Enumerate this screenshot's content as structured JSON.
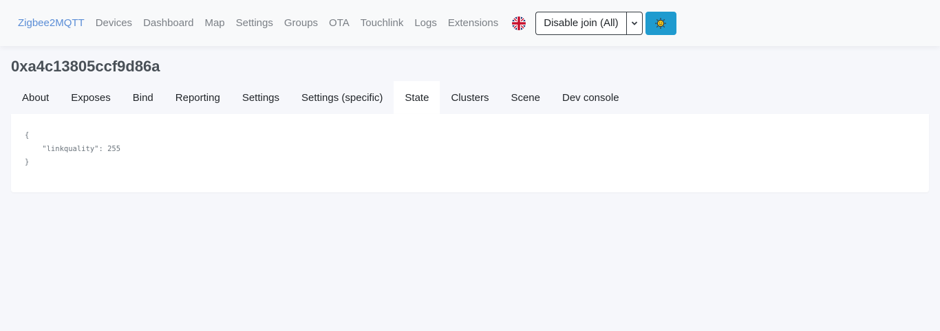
{
  "navbar": {
    "brand": "Zigbee2MQTT",
    "links": [
      "Devices",
      "Dashboard",
      "Map",
      "Settings",
      "Groups",
      "OTA",
      "Touchlink",
      "Logs",
      "Extensions"
    ],
    "language_icon": "uk-flag-icon",
    "join_button": "Disable join (All)",
    "caret_icon": "chevron-down-icon",
    "theme_icon": "sun-icon"
  },
  "page": {
    "title": "0xa4c13805ccf9d86a"
  },
  "tabs": [
    {
      "label": "About",
      "active": false
    },
    {
      "label": "Exposes",
      "active": false
    },
    {
      "label": "Bind",
      "active": false
    },
    {
      "label": "Reporting",
      "active": false
    },
    {
      "label": "Settings",
      "active": false
    },
    {
      "label": "Settings (specific)",
      "active": false
    },
    {
      "label": "State",
      "active": true
    },
    {
      "label": "Clusters",
      "active": false
    },
    {
      "label": "Scene",
      "active": false
    },
    {
      "label": "Dev console",
      "active": false
    }
  ],
  "state": {
    "json_text": "{\n    \"linkquality\": 255\n}"
  },
  "colors": {
    "brand": "#5a8dd6",
    "theme_button": "#1f9bcf",
    "background": "#f6f7fb"
  }
}
